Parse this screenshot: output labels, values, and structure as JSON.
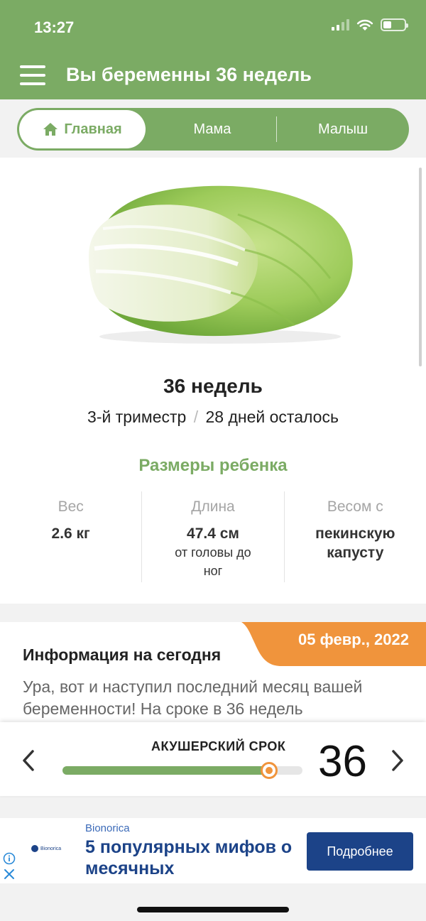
{
  "status_bar": {
    "time": "13:27"
  },
  "header": {
    "title": "Вы беременны 36 недель"
  },
  "tabs": [
    {
      "label": "Главная",
      "active": true
    },
    {
      "label": "Мама",
      "active": false
    },
    {
      "label": "Малыш",
      "active": false
    }
  ],
  "summary": {
    "weeks": "36 недель",
    "trimester": "3-й триместр",
    "separator": "/",
    "days_left": "28 дней осталось",
    "sizes_title": "Размеры ребенка",
    "stats": [
      {
        "label": "Вес",
        "value": "2.6 кг",
        "sub": ""
      },
      {
        "label": "Длина",
        "value": "47.4 см",
        "sub": "от головы до ног"
      },
      {
        "label": "Весом с",
        "value": "пекинскую капусту",
        "sub": ""
      }
    ]
  },
  "info": {
    "date": "05 февр., 2022",
    "title": "Информация на сегодня",
    "text": "Ура, вот и наступил последний месяц вашей беременности! На сроке в 36 недель"
  },
  "term_bar": {
    "label": "АКУШЕРСКИЙ СРОК",
    "week": "36",
    "progress": 0.86
  },
  "ad": {
    "logo_text": "Bionorica",
    "brand": "Bionorica",
    "headline": "5 популярных мифов о месячных",
    "button": "Подробнее"
  },
  "colors": {
    "brand_green": "#7bab64",
    "accent_orange": "#f0943c",
    "ad_blue": "#1c4388"
  },
  "icons": [
    "hamburger-icon",
    "home-icon",
    "chevron-left-icon",
    "chevron-right-icon",
    "info-icon",
    "close-icon",
    "wifi-icon",
    "battery-icon",
    "signal-icon"
  ]
}
